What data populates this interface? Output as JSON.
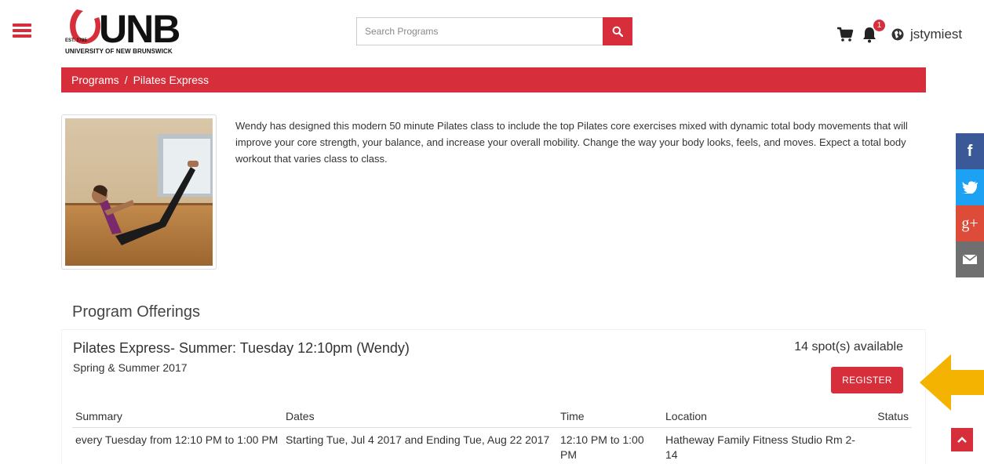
{
  "header": {
    "logo": {
      "wordmark": "UNB",
      "established": "EST. 1785",
      "subtitle": "UNIVERSITY OF NEW BRUNSWICK"
    },
    "search": {
      "placeholder": "Search Programs",
      "value": ""
    },
    "notifications_count": "1",
    "username": "jstymiest"
  },
  "breadcrumb": {
    "items": [
      "Programs",
      "Pilates Express"
    ],
    "separator": "/"
  },
  "program": {
    "description": "Wendy has designed this modern 50 minute Pilates class to include the top Pilates core exercises mixed with dynamic total body movements that will improve your core strength, your balance, and increase your overall mobility. Change the way your body looks, feels, and moves. Expect a total body workout that varies class to class."
  },
  "social": [
    {
      "icon": "facebook-icon",
      "glyph": "f",
      "color": "#3b5998"
    },
    {
      "icon": "twitter-icon",
      "glyph": "",
      "color": "#1da1f2"
    },
    {
      "icon": "google-plus-icon",
      "glyph": "g+",
      "color": "#dd4b39"
    },
    {
      "icon": "email-icon",
      "glyph": "",
      "color": "#6f6f6f"
    }
  ],
  "offerings": {
    "heading": "Program Offerings",
    "items": [
      {
        "title": "Pilates Express- Summer: Tuesday 12:10pm (Wendy)",
        "season": "Spring & Summer 2017",
        "spots": "14 spot(s) available",
        "register_label": "REGISTER",
        "columns": [
          "Summary",
          "Dates",
          "Time",
          "Location",
          "Status"
        ],
        "rows": [
          {
            "summary": "every Tuesday from 12:10 PM to 1:00 PM",
            "dates": "Starting Tue, Jul 4 2017 and Ending Tue, Aug 22 2017",
            "time": "12:10 PM to 1:00 PM",
            "location": "Hatheway Family Fitness Studio Rm 2-14",
            "status": ""
          }
        ]
      }
    ]
  },
  "colors": {
    "brand_red": "#d62e3a",
    "arrow_yellow": "#f5b301"
  }
}
